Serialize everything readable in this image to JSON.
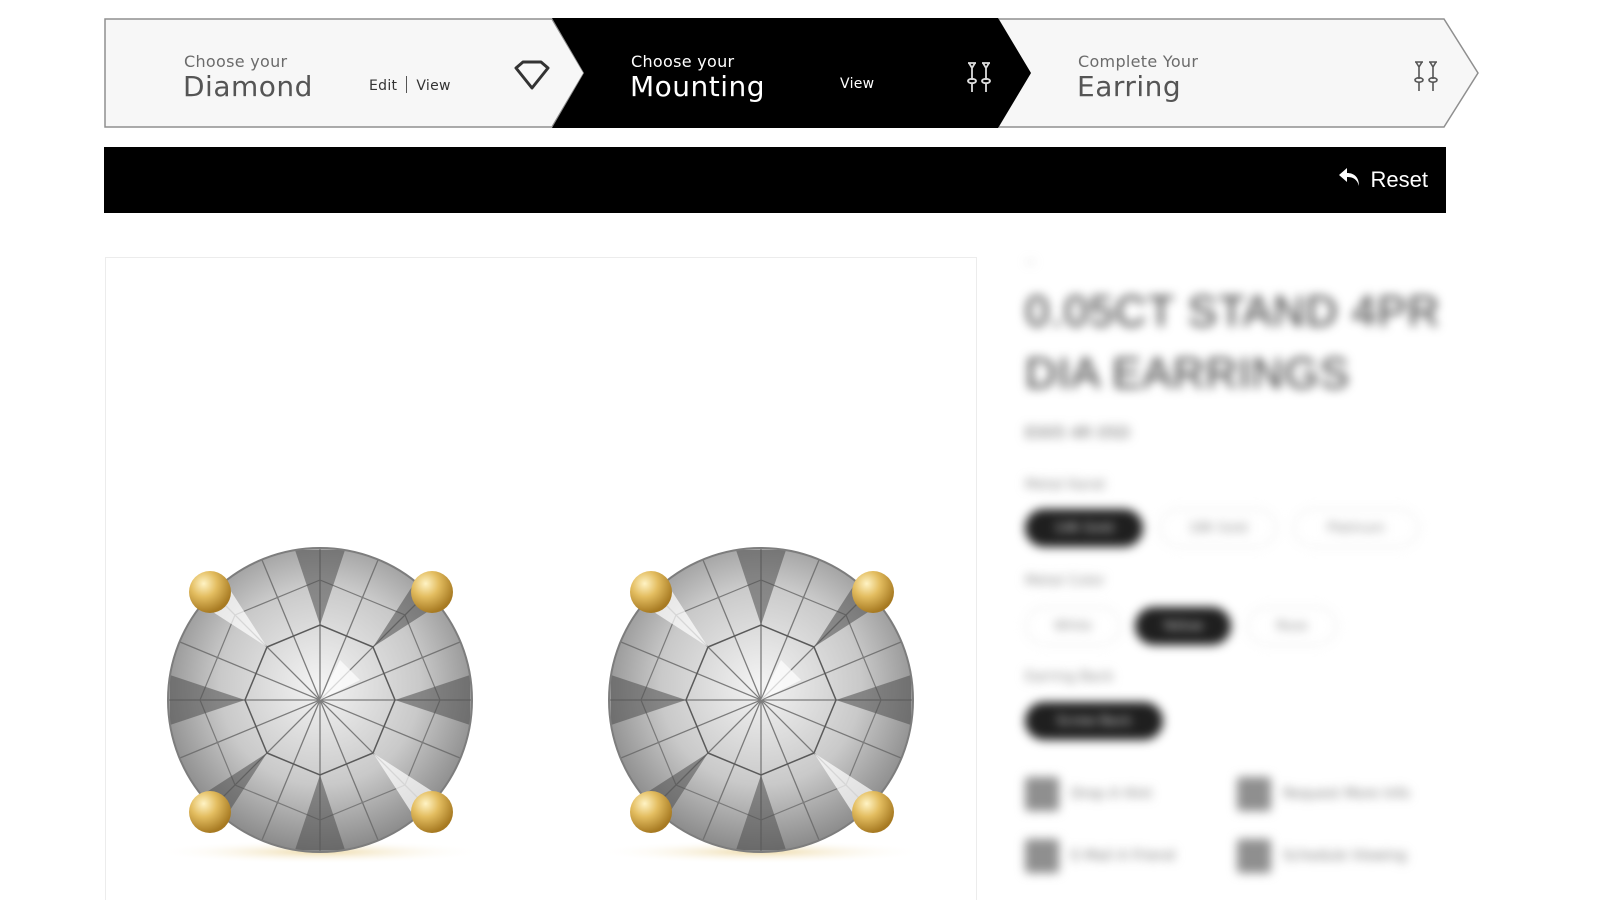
{
  "steps": [
    {
      "small": "Choose your",
      "big": "Diamond",
      "link_edit": "Edit",
      "link_view": "View",
      "icon": "diamond-outline-icon",
      "state": "completed"
    },
    {
      "small": "Choose your",
      "big": "Mounting",
      "link_view": "View",
      "icon": "earring-studs-icon",
      "state": "active"
    },
    {
      "small": "Complete Your",
      "big": "Earring",
      "icon": "earring-studs-icon",
      "state": "pending"
    }
  ],
  "toolbar": {
    "reset_label": "Reset",
    "reset_icon": "undo-arrow-icon"
  },
  "product": {
    "image_alt": "0.05CT STAND 4PR DIA EARRINGS",
    "crumb": "~",
    "title": "0.05CT STAND 4PR DIA EARRINGS",
    "sku": "E005 4R 05D",
    "metal_label": "Metal Karat",
    "metal_options": [
      "14K Gold",
      "18K Gold",
      "Platinum"
    ],
    "metal_selected": 0,
    "color_label": "Metal Color",
    "color_options": [
      "White",
      "Yellow",
      "Rose"
    ],
    "color_selected": 1,
    "backing_label": "Earring Back",
    "backing_options": [
      "Screw Back"
    ],
    "backing_selected": 0,
    "features": [
      "Drop A Hint",
      "Request More Info",
      "E-Mail A Friend",
      "Schedule Viewing"
    ]
  },
  "colors": {
    "active_step_bg": "#000000",
    "step_bg": "#f7f7f7",
    "border": "#9a9a9a",
    "gold": "#d4a94a"
  }
}
